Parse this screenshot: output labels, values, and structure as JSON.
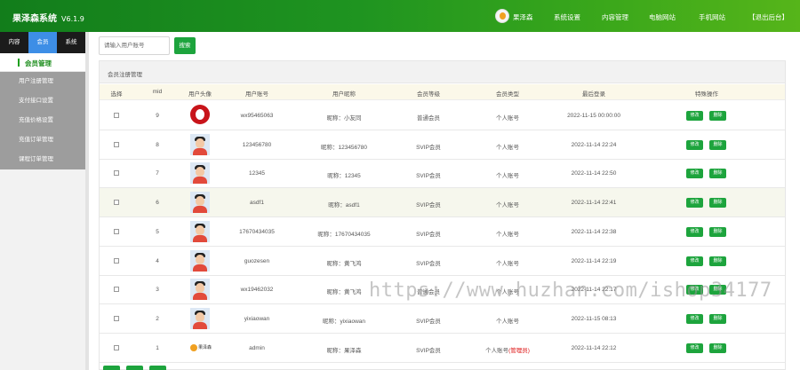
{
  "header": {
    "brand": "果泽森系统",
    "version": "V6.1.9",
    "user_name": "果泽森",
    "nav": [
      "系统设置",
      "内容管理",
      "电脑网站",
      "手机网站",
      "【退出后台】"
    ]
  },
  "sidebar": {
    "tabs": [
      "内容",
      "会员",
      "系统"
    ],
    "active_tab": 1,
    "section_title": "会员管理",
    "items": [
      "用户注册管理",
      "支付接口设置",
      "充值价格设置",
      "充值订单管理",
      "课程订单管理"
    ]
  },
  "search": {
    "placeholder": "请输入用户账号",
    "button": "搜索"
  },
  "panel": {
    "title": "会员注册管理",
    "columns": [
      "选择",
      "mid",
      "用户头像",
      "用户账号",
      "用户昵称",
      "会员等级",
      "会员类型",
      "最后登录",
      "特殊操作"
    ]
  },
  "buttons": {
    "edit": "修改",
    "delete": "删除"
  },
  "rows": [
    {
      "mid": "9",
      "avatar": "logo",
      "account": "wx95465063",
      "nickname": "昵称：小友同",
      "level": "普通会员",
      "type": "个人账号",
      "type_tag": "",
      "last_login": "2022-11-15 00:00:00"
    },
    {
      "mid": "8",
      "avatar": "girl",
      "account": "123456780",
      "nickname": "昵称：123456780",
      "level": "SVIP会员",
      "type": "个人账号",
      "type_tag": "",
      "last_login": "2022-11-14 22:24"
    },
    {
      "mid": "7",
      "avatar": "girl",
      "account": "12345",
      "nickname": "昵称：12345",
      "level": "SVIP会员",
      "type": "个人账号",
      "type_tag": "",
      "last_login": "2022-11-14 22:50"
    },
    {
      "mid": "6",
      "avatar": "girl",
      "account": "asdf1",
      "nickname": "昵称：asdf1",
      "level": "SVIP会员",
      "type": "个人账号",
      "type_tag": "",
      "last_login": "2022-11-14 22:41"
    },
    {
      "mid": "5",
      "avatar": "girl",
      "account": "17670434035",
      "nickname": "昵称：17670434035",
      "level": "SVIP会员",
      "type": "个人账号",
      "type_tag": "",
      "last_login": "2022-11-14 22:38"
    },
    {
      "mid": "4",
      "avatar": "girl",
      "account": "guozesen",
      "nickname": "昵称：黄飞鸿",
      "level": "SVIP会员",
      "type": "个人账号",
      "type_tag": "",
      "last_login": "2022-11-14 22:19"
    },
    {
      "mid": "3",
      "avatar": "girl",
      "account": "wx19462032",
      "nickname": "昵称：黄飞鸿",
      "level": "普通会员",
      "type": "个人账号",
      "type_tag": "",
      "last_login": "2022-11-14 22:17"
    },
    {
      "mid": "2",
      "avatar": "girl",
      "account": "yixiaowan",
      "nickname": "昵称：yixiaowan",
      "level": "SVIP会员",
      "type": "个人账号",
      "type_tag": "",
      "last_login": "2022-11-15 08:13"
    },
    {
      "mid": "1",
      "avatar": "fruit",
      "account": "admin",
      "nickname": "昵称：果泽森",
      "level": "SVIP会员",
      "type": "个人账号",
      "type_tag": "(管理员)",
      "last_login": "2022-11-14 22:12"
    }
  ],
  "watermark": "https://www.huzhan.com/ishop34177",
  "colors": {
    "brand_green": "#1da43d",
    "header_dark": "#127d1b",
    "tab_active": "#3d8ee6",
    "sidebar_grey": "#9d9d9d"
  },
  "icons": {
    "user_avatar": "fruit-logo-icon",
    "row_checkbox": "checkbox-icon"
  }
}
